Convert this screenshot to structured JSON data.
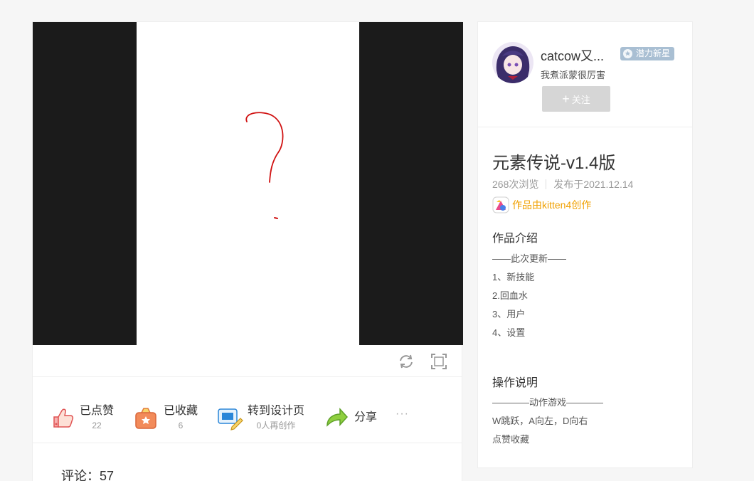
{
  "player": {
    "controls": {
      "restart": "restart-icon",
      "fullscreen": "fullscreen-icon"
    }
  },
  "actions": {
    "like": {
      "label": "已点赞",
      "count": "22",
      "icon": "thumbs-up-icon"
    },
    "favorite": {
      "label": "已收藏",
      "count": "6",
      "icon": "favorite-basket-icon"
    },
    "remix": {
      "label": "转到设计页",
      "sub": "0人再创作",
      "icon": "design-page-icon"
    },
    "share": {
      "label": "分享",
      "icon": "share-arrow-icon"
    },
    "more": "···"
  },
  "comments": {
    "label": "评论：57"
  },
  "author": {
    "name": "catcow又...",
    "badge": "潜力新星",
    "bio": "我煮派蒙很厉害",
    "follow_label": "关注"
  },
  "work": {
    "title": "元素传说-v1.4版",
    "views": "268次浏览",
    "published": "发布于2021.12.14",
    "made_with": "作品由kitten4创作"
  },
  "intro": {
    "heading": "作品介绍",
    "lines": [
      "——此次更新——",
      "1、新技能",
      "2.回血水",
      "3、用户",
      "4、设置"
    ]
  },
  "instructions": {
    "heading": "操作说明",
    "lines": [
      "————动作游戏————",
      "W跳跃，A向左，D向右",
      "点赞收藏"
    ]
  },
  "colors": {
    "accent": "#f0a000",
    "stage_bg": "#1b1b1b",
    "follow_disabled": "#d6d6d6",
    "badge": "#a9bfd3"
  }
}
